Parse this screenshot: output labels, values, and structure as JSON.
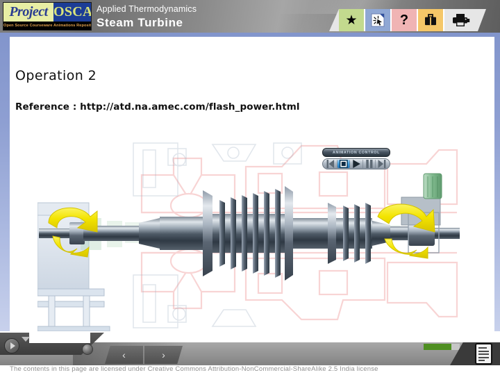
{
  "header": {
    "logo": {
      "word1": "Project",
      "word2": "OSCAR",
      "tagline": "Open Source Courseware Animations Repository"
    },
    "subject": "Applied Thermodynamics",
    "title": "Steam Turbine",
    "toolbar": [
      {
        "name": "favorites",
        "icon": "star-icon",
        "glyph": "★",
        "color": "#c3da8e"
      },
      {
        "name": "interact",
        "icon": "cursor-click-icon",
        "glyph": "",
        "color": "#8fa7d4"
      },
      {
        "name": "help",
        "icon": "question-mark-icon",
        "glyph": "?",
        "color": "#f0b4b4"
      },
      {
        "name": "resources",
        "icon": "briefcase-icon",
        "glyph": "",
        "color": "#f5c768"
      },
      {
        "name": "print",
        "icon": "printer-icon",
        "glyph": "",
        "color": "#e6e6e6"
      }
    ]
  },
  "content": {
    "operation_title": "Operation 2",
    "reference": "Reference : http://atd.na.amec.com/flash_power.html"
  },
  "animation_control": {
    "label": "ANIMATION CONTROL",
    "buttons": [
      {
        "name": "rewind",
        "icon": "skip-back-icon",
        "active": false
      },
      {
        "name": "stop",
        "icon": "stop-icon",
        "active": true
      },
      {
        "name": "play",
        "icon": "play-icon",
        "active": false
      },
      {
        "name": "pause",
        "icon": "pause-icon",
        "active": false
      },
      {
        "name": "forward",
        "icon": "skip-forward-icon",
        "active": false
      }
    ]
  },
  "figure": {
    "name": "steam-turbine-rotor-diagram",
    "colors": {
      "rotor": "#5d6a77",
      "rotor_light": "#c2cbd4",
      "casing_outline": "#f0a6a6",
      "arrow": "#f2e200",
      "accent_green": "#8fc49a"
    },
    "rotation_arrows": 2
  },
  "footer": {
    "play_button": "play-icon",
    "prev_label": "‹",
    "next_label": "›",
    "progress_percent": 77,
    "progress_color": "#4f8f22",
    "notes_icon": "document-notes-icon",
    "license": "The contents in this page are licensed under Creative Commons Attribution-NonCommercial-ShareAlike 2.5 India license"
  }
}
